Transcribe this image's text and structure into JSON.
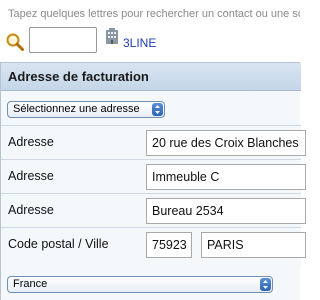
{
  "search": {
    "hint": "Tapez quelques lettres pour rechercher un contact ou une so",
    "input_value": "",
    "icon": "magnifier-icon",
    "company_icon": "building-icon",
    "company_name": "3LINE"
  },
  "billing": {
    "title": "Adresse de facturation",
    "address_select": "Sélectionnez une adresse",
    "rows": [
      {
        "label": "Adresse",
        "value": "20 rue des Croix Blanches"
      },
      {
        "label": "Adresse",
        "value": "Immeuble C"
      },
      {
        "label": "Adresse",
        "value": "Bureau 2534"
      }
    ],
    "postal_city": {
      "label": "Code postal / Ville",
      "postal_code": "75923",
      "city": "PARIS"
    },
    "country": "France"
  },
  "colors": {
    "header_bg": "#c9daea",
    "link": "#1f3fb0",
    "select_arrow": "#3a71c0"
  }
}
